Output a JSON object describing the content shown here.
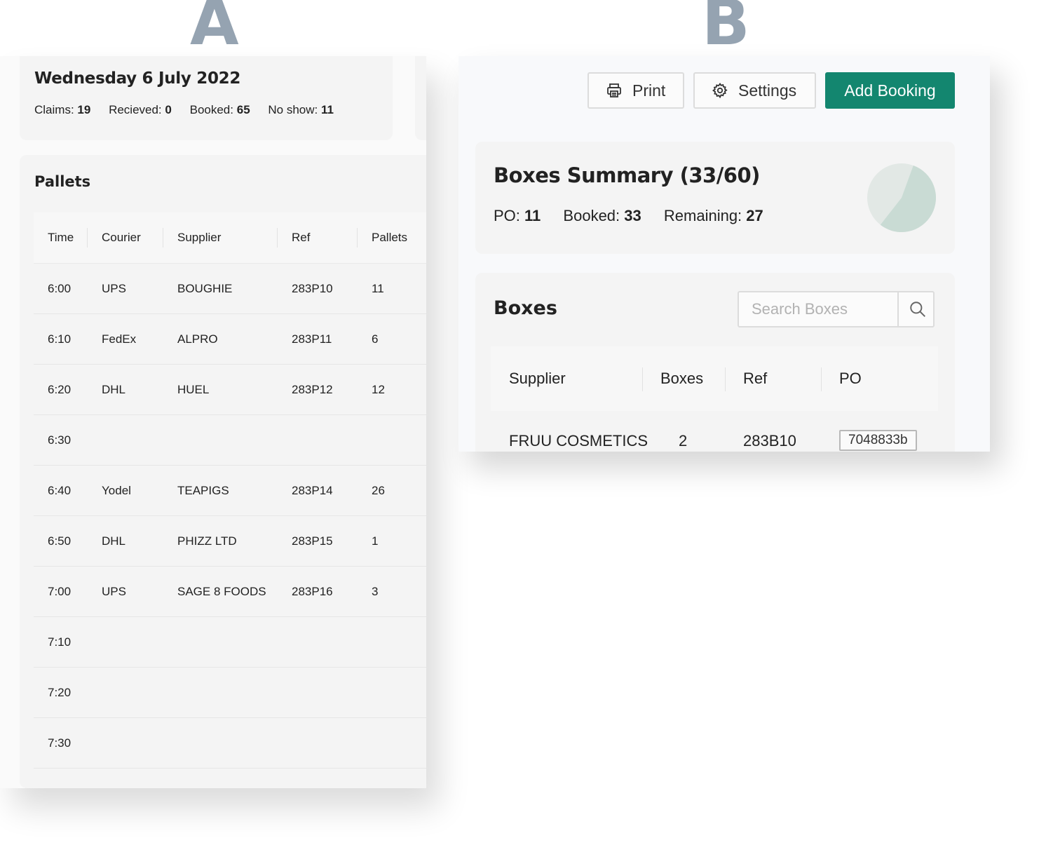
{
  "labels": {
    "panel_a": "A",
    "panel_b": "B"
  },
  "colors": {
    "accent": "#13866f",
    "letter": "#95a3b1",
    "pie_main": "#c9dbd4",
    "pie_secondary": "#e2e8e5"
  },
  "day": {
    "title": "Wednesday 6 July 2022",
    "stats": [
      {
        "label": "Claims:",
        "value": "19"
      },
      {
        "label": "Recieved:",
        "value": "0"
      },
      {
        "label": "Booked:",
        "value": "65"
      },
      {
        "label": "No show:",
        "value": "11"
      }
    ]
  },
  "pallets": {
    "title": "Pallets",
    "columns": [
      "Time",
      "Courier",
      "Supplier",
      "Ref",
      "Pallets"
    ],
    "rows": [
      {
        "time": "6:00",
        "courier": "UPS",
        "supplier": "BOUGHIE",
        "ref": "283P10",
        "pallets": "11"
      },
      {
        "time": "6:10",
        "courier": "FedEx",
        "supplier": "ALPRO",
        "ref": "283P11",
        "pallets": "6"
      },
      {
        "time": "6:20",
        "courier": "DHL",
        "supplier": "HUEL",
        "ref": "283P12",
        "pallets": "12"
      },
      {
        "time": "6:30",
        "courier": "",
        "supplier": "",
        "ref": "",
        "pallets": ""
      },
      {
        "time": "6:40",
        "courier": "Yodel",
        "supplier": "TEAPIGS",
        "ref": "283P14",
        "pallets": "26"
      },
      {
        "time": "6:50",
        "courier": "DHL",
        "supplier": "PHIZZ LTD",
        "ref": "283P15",
        "pallets": "1"
      },
      {
        "time": "7:00",
        "courier": "UPS",
        "supplier": "SAGE 8 FOODS",
        "ref": "283P16",
        "pallets": "3"
      },
      {
        "time": "7:10",
        "courier": "",
        "supplier": "",
        "ref": "",
        "pallets": ""
      },
      {
        "time": "7:20",
        "courier": "",
        "supplier": "",
        "ref": "",
        "pallets": ""
      },
      {
        "time": "7:30",
        "courier": "",
        "supplier": "",
        "ref": "",
        "pallets": ""
      }
    ]
  },
  "toolbar": {
    "print_label": "Print",
    "print_icon": "printer-icon",
    "settings_label": "Settings",
    "settings_icon": "gear-icon",
    "add_label": "Add Booking"
  },
  "summary": {
    "title": "Boxes Summary (33/60)",
    "stats": [
      {
        "label": "PO:",
        "value": "11"
      },
      {
        "label": "Booked:",
        "value": "33"
      },
      {
        "label": "Remaining:",
        "value": "27"
      }
    ],
    "pie": {
      "booked": 33,
      "total": 60
    }
  },
  "boxes": {
    "title": "Boxes",
    "search_placeholder": "Search Boxes",
    "search_icon": "magnifier-icon",
    "columns": [
      "Supplier",
      "Boxes",
      "Ref",
      "PO"
    ],
    "rows": [
      {
        "supplier": "FRUU COSMETICS",
        "boxes": "2",
        "ref": "283B10",
        "po": "7048833b"
      }
    ]
  }
}
